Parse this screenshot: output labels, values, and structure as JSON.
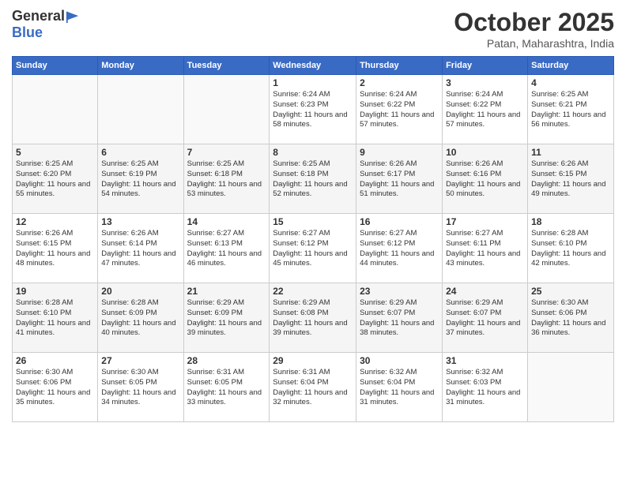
{
  "logo": {
    "general": "General",
    "blue": "Blue"
  },
  "header": {
    "month": "October 2025",
    "location": "Patan, Maharashtra, India"
  },
  "weekdays": [
    "Sunday",
    "Monday",
    "Tuesday",
    "Wednesday",
    "Thursday",
    "Friday",
    "Saturday"
  ],
  "weeks": [
    [
      {
        "day": "",
        "sunrise": "",
        "sunset": "",
        "daylight": ""
      },
      {
        "day": "",
        "sunrise": "",
        "sunset": "",
        "daylight": ""
      },
      {
        "day": "",
        "sunrise": "",
        "sunset": "",
        "daylight": ""
      },
      {
        "day": "1",
        "sunrise": "Sunrise: 6:24 AM",
        "sunset": "Sunset: 6:23 PM",
        "daylight": "Daylight: 11 hours and 58 minutes."
      },
      {
        "day": "2",
        "sunrise": "Sunrise: 6:24 AM",
        "sunset": "Sunset: 6:22 PM",
        "daylight": "Daylight: 11 hours and 57 minutes."
      },
      {
        "day": "3",
        "sunrise": "Sunrise: 6:24 AM",
        "sunset": "Sunset: 6:22 PM",
        "daylight": "Daylight: 11 hours and 57 minutes."
      },
      {
        "day": "4",
        "sunrise": "Sunrise: 6:25 AM",
        "sunset": "Sunset: 6:21 PM",
        "daylight": "Daylight: 11 hours and 56 minutes."
      }
    ],
    [
      {
        "day": "5",
        "sunrise": "Sunrise: 6:25 AM",
        "sunset": "Sunset: 6:20 PM",
        "daylight": "Daylight: 11 hours and 55 minutes."
      },
      {
        "day": "6",
        "sunrise": "Sunrise: 6:25 AM",
        "sunset": "Sunset: 6:19 PM",
        "daylight": "Daylight: 11 hours and 54 minutes."
      },
      {
        "day": "7",
        "sunrise": "Sunrise: 6:25 AM",
        "sunset": "Sunset: 6:18 PM",
        "daylight": "Daylight: 11 hours and 53 minutes."
      },
      {
        "day": "8",
        "sunrise": "Sunrise: 6:25 AM",
        "sunset": "Sunset: 6:18 PM",
        "daylight": "Daylight: 11 hours and 52 minutes."
      },
      {
        "day": "9",
        "sunrise": "Sunrise: 6:26 AM",
        "sunset": "Sunset: 6:17 PM",
        "daylight": "Daylight: 11 hours and 51 minutes."
      },
      {
        "day": "10",
        "sunrise": "Sunrise: 6:26 AM",
        "sunset": "Sunset: 6:16 PM",
        "daylight": "Daylight: 11 hours and 50 minutes."
      },
      {
        "day": "11",
        "sunrise": "Sunrise: 6:26 AM",
        "sunset": "Sunset: 6:15 PM",
        "daylight": "Daylight: 11 hours and 49 minutes."
      }
    ],
    [
      {
        "day": "12",
        "sunrise": "Sunrise: 6:26 AM",
        "sunset": "Sunset: 6:15 PM",
        "daylight": "Daylight: 11 hours and 48 minutes."
      },
      {
        "day": "13",
        "sunrise": "Sunrise: 6:26 AM",
        "sunset": "Sunset: 6:14 PM",
        "daylight": "Daylight: 11 hours and 47 minutes."
      },
      {
        "day": "14",
        "sunrise": "Sunrise: 6:27 AM",
        "sunset": "Sunset: 6:13 PM",
        "daylight": "Daylight: 11 hours and 46 minutes."
      },
      {
        "day": "15",
        "sunrise": "Sunrise: 6:27 AM",
        "sunset": "Sunset: 6:12 PM",
        "daylight": "Daylight: 11 hours and 45 minutes."
      },
      {
        "day": "16",
        "sunrise": "Sunrise: 6:27 AM",
        "sunset": "Sunset: 6:12 PM",
        "daylight": "Daylight: 11 hours and 44 minutes."
      },
      {
        "day": "17",
        "sunrise": "Sunrise: 6:27 AM",
        "sunset": "Sunset: 6:11 PM",
        "daylight": "Daylight: 11 hours and 43 minutes."
      },
      {
        "day": "18",
        "sunrise": "Sunrise: 6:28 AM",
        "sunset": "Sunset: 6:10 PM",
        "daylight": "Daylight: 11 hours and 42 minutes."
      }
    ],
    [
      {
        "day": "19",
        "sunrise": "Sunrise: 6:28 AM",
        "sunset": "Sunset: 6:10 PM",
        "daylight": "Daylight: 11 hours and 41 minutes."
      },
      {
        "day": "20",
        "sunrise": "Sunrise: 6:28 AM",
        "sunset": "Sunset: 6:09 PM",
        "daylight": "Daylight: 11 hours and 40 minutes."
      },
      {
        "day": "21",
        "sunrise": "Sunrise: 6:29 AM",
        "sunset": "Sunset: 6:09 PM",
        "daylight": "Daylight: 11 hours and 39 minutes."
      },
      {
        "day": "22",
        "sunrise": "Sunrise: 6:29 AM",
        "sunset": "Sunset: 6:08 PM",
        "daylight": "Daylight: 11 hours and 39 minutes."
      },
      {
        "day": "23",
        "sunrise": "Sunrise: 6:29 AM",
        "sunset": "Sunset: 6:07 PM",
        "daylight": "Daylight: 11 hours and 38 minutes."
      },
      {
        "day": "24",
        "sunrise": "Sunrise: 6:29 AM",
        "sunset": "Sunset: 6:07 PM",
        "daylight": "Daylight: 11 hours and 37 minutes."
      },
      {
        "day": "25",
        "sunrise": "Sunrise: 6:30 AM",
        "sunset": "Sunset: 6:06 PM",
        "daylight": "Daylight: 11 hours and 36 minutes."
      }
    ],
    [
      {
        "day": "26",
        "sunrise": "Sunrise: 6:30 AM",
        "sunset": "Sunset: 6:06 PM",
        "daylight": "Daylight: 11 hours and 35 minutes."
      },
      {
        "day": "27",
        "sunrise": "Sunrise: 6:30 AM",
        "sunset": "Sunset: 6:05 PM",
        "daylight": "Daylight: 11 hours and 34 minutes."
      },
      {
        "day": "28",
        "sunrise": "Sunrise: 6:31 AM",
        "sunset": "Sunset: 6:05 PM",
        "daylight": "Daylight: 11 hours and 33 minutes."
      },
      {
        "day": "29",
        "sunrise": "Sunrise: 6:31 AM",
        "sunset": "Sunset: 6:04 PM",
        "daylight": "Daylight: 11 hours and 32 minutes."
      },
      {
        "day": "30",
        "sunrise": "Sunrise: 6:32 AM",
        "sunset": "Sunset: 6:04 PM",
        "daylight": "Daylight: 11 hours and 31 minutes."
      },
      {
        "day": "31",
        "sunrise": "Sunrise: 6:32 AM",
        "sunset": "Sunset: 6:03 PM",
        "daylight": "Daylight: 11 hours and 31 minutes."
      },
      {
        "day": "",
        "sunrise": "",
        "sunset": "",
        "daylight": ""
      }
    ]
  ]
}
